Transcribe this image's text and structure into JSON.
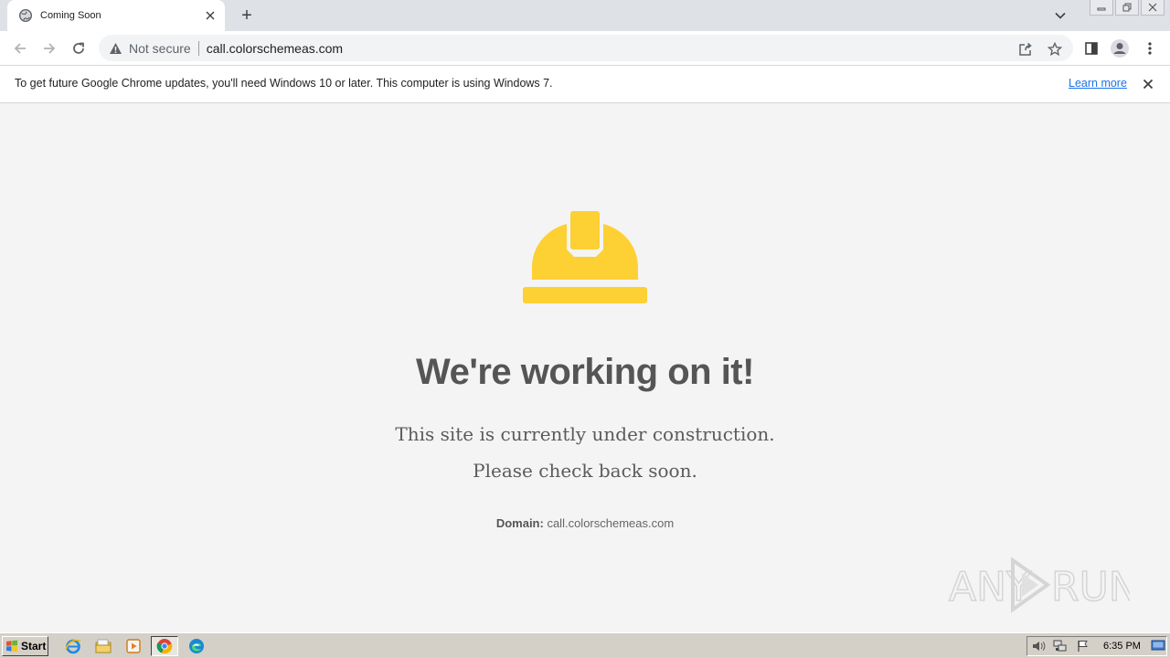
{
  "browser": {
    "tab_title": "Coming Soon",
    "new_tab_symbol": "+",
    "omnibox": {
      "security_label": "Not secure",
      "url": "call.colorschemeas.com"
    }
  },
  "infobar": {
    "message": "To get future Google Chrome updates, you'll need Windows 10 or later. This computer is using Windows 7.",
    "link_label": "Learn more"
  },
  "page": {
    "headline": "We're working on it!",
    "line1": "This site is currently under construction.",
    "line2": "Please check back soon.",
    "domain_label": "Domain:",
    "domain_value": "call.colorschemeas.com",
    "helmet_color": "#fdd033",
    "watermark_text": "ANY RUN"
  },
  "taskbar": {
    "start_label": "Start",
    "clock": "6:35 PM",
    "icons": [
      "ie-icon",
      "explorer-icon",
      "media-player-icon",
      "chrome-icon",
      "edge-icon"
    ]
  },
  "colors": {
    "tab_strip": "#dee1e6",
    "omnibox": "#f1f3f4",
    "link": "#1a73e8",
    "page_bg": "#f4f4f4",
    "heading_text": "#555555",
    "taskbar": "#d4d0c8"
  }
}
